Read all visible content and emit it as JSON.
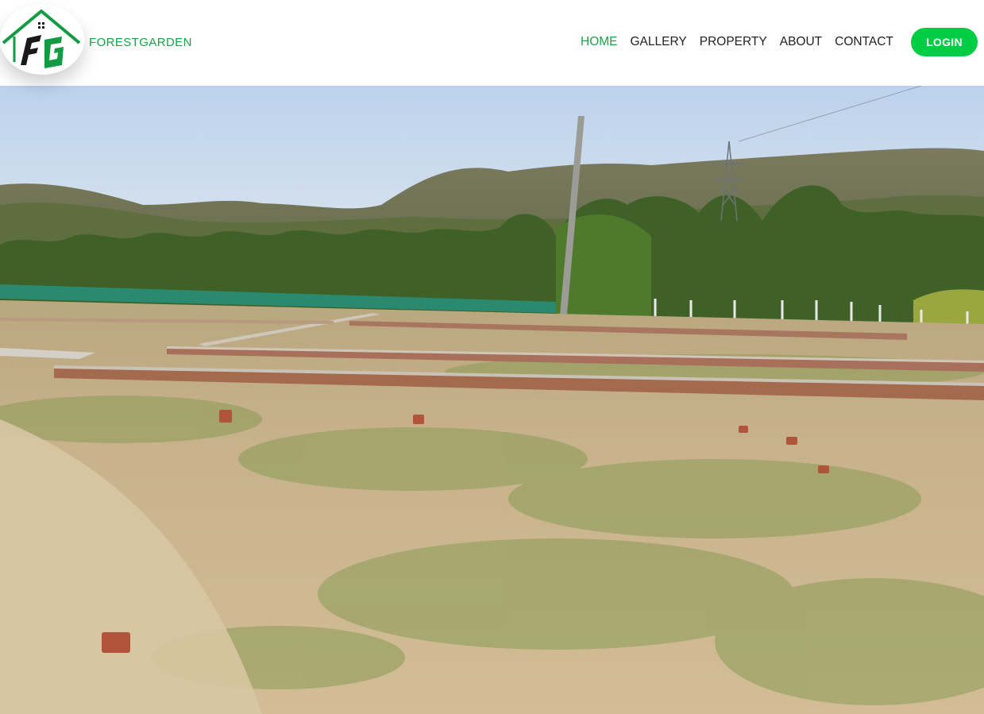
{
  "brand": {
    "name": "FORESTGARDEN",
    "logo_icon": "house-fg-logo-icon",
    "logo_letters": "FG",
    "color": "#17a34a"
  },
  "nav": {
    "items": [
      {
        "label": "HOME",
        "active": true
      },
      {
        "label": "GALLERY",
        "active": false
      },
      {
        "label": "PROPERTY",
        "active": false
      },
      {
        "label": "ABOUT",
        "active": false
      },
      {
        "label": "CONTACT",
        "active": false
      }
    ]
  },
  "login": {
    "label": "LOGIN",
    "color": "#00cc44"
  },
  "hero": {
    "image": "land-plots-with-brick-boundaries-hills-background"
  }
}
